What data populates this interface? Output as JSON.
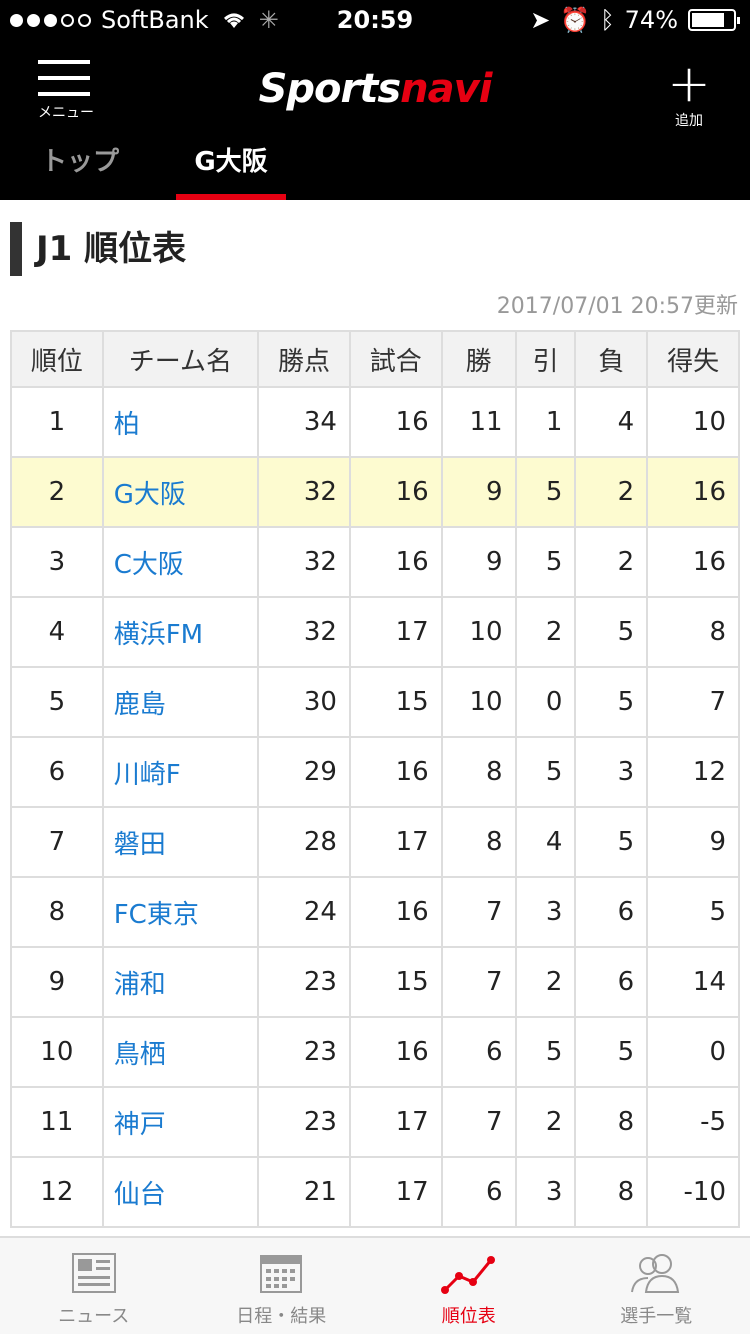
{
  "statusbar": {
    "carrier": "SoftBank",
    "time": "20:59",
    "battery": "74%"
  },
  "header": {
    "menu_label": "メニュー",
    "logo_part1": "Sports",
    "logo_part2": "navi",
    "add_label": "追加"
  },
  "tabs": [
    {
      "label": "トップ"
    },
    {
      "label": "G大阪"
    }
  ],
  "section": {
    "title": "J1 順位表",
    "updated": "2017/07/01 20:57更新"
  },
  "table": {
    "headers": [
      "順位",
      "チーム名",
      "勝点",
      "試合",
      "勝",
      "引",
      "負",
      "得失"
    ],
    "rows": [
      [
        "1",
        "柏",
        "34",
        "16",
        "11",
        "1",
        "4",
        "10"
      ],
      [
        "2",
        "G大阪",
        "32",
        "16",
        "9",
        "5",
        "2",
        "16"
      ],
      [
        "3",
        "C大阪",
        "32",
        "16",
        "9",
        "5",
        "2",
        "16"
      ],
      [
        "4",
        "横浜FM",
        "32",
        "17",
        "10",
        "2",
        "5",
        "8"
      ],
      [
        "5",
        "鹿島",
        "30",
        "15",
        "10",
        "0",
        "5",
        "7"
      ],
      [
        "6",
        "川崎F",
        "29",
        "16",
        "8",
        "5",
        "3",
        "12"
      ],
      [
        "7",
        "磐田",
        "28",
        "17",
        "8",
        "4",
        "5",
        "9"
      ],
      [
        "8",
        "FC東京",
        "24",
        "16",
        "7",
        "3",
        "6",
        "5"
      ],
      [
        "9",
        "浦和",
        "23",
        "15",
        "7",
        "2",
        "6",
        "14"
      ],
      [
        "10",
        "鳥栖",
        "23",
        "16",
        "6",
        "5",
        "5",
        "0"
      ],
      [
        "11",
        "神戸",
        "23",
        "17",
        "7",
        "2",
        "8",
        "-5"
      ],
      [
        "12",
        "仙台",
        "21",
        "17",
        "6",
        "3",
        "8",
        "-10"
      ]
    ]
  },
  "tabbar": [
    {
      "label": "ニュース",
      "icon": "news-icon"
    },
    {
      "label": "日程・結果",
      "icon": "calendar-icon"
    },
    {
      "label": "順位表",
      "icon": "chart-icon"
    },
    {
      "label": "選手一覧",
      "icon": "players-icon"
    }
  ],
  "colors": {
    "accent": "#e60012",
    "link": "#1a7bd0",
    "highlight": "#fdfbd0"
  }
}
